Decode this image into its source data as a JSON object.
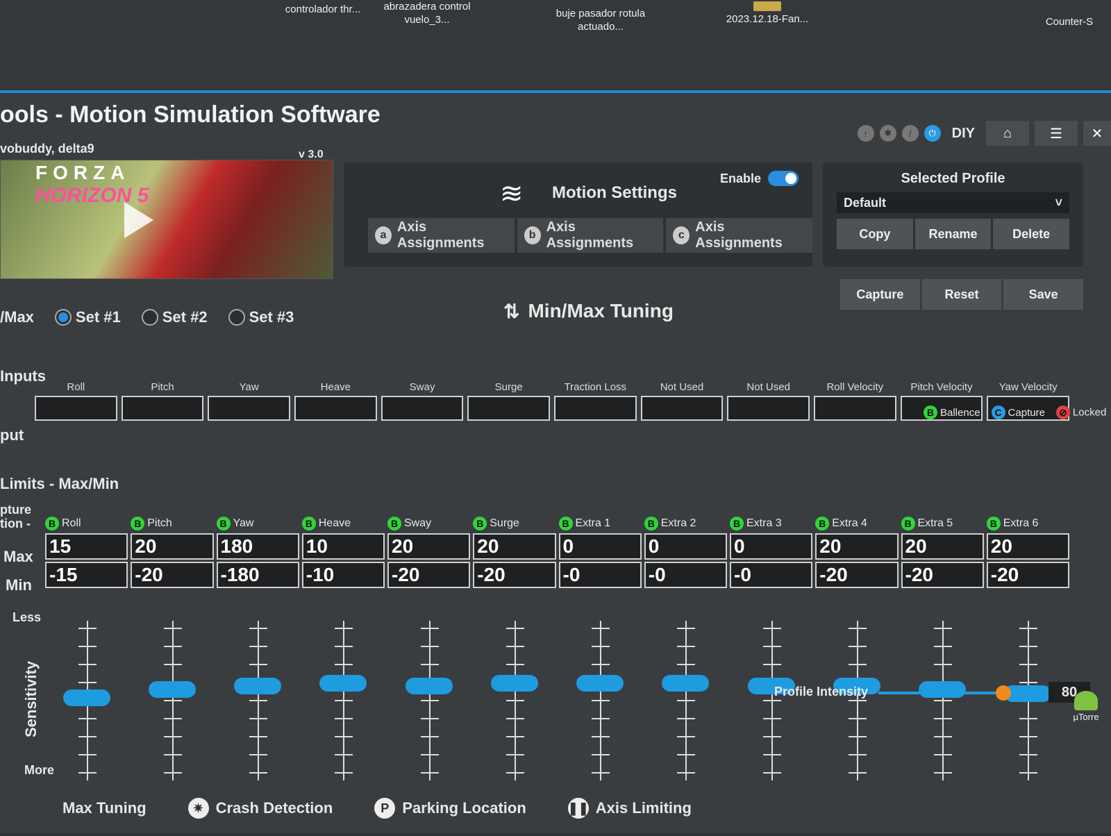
{
  "desktop": {
    "icons": [
      "controlador thr...",
      "abrazadera control vuelo_3...",
      "buje pasador rotula actuado...",
      "2023.12.18-Fan...",
      "Counter-S",
      "µTorre"
    ]
  },
  "window": {
    "title": "ools - Motion Simulation Software",
    "credit": "vobuddy, delta9",
    "version": "v 3.0",
    "mode": "DIY",
    "close": "✕"
  },
  "game": {
    "brand": "FORZA",
    "name": "HORIZON 5"
  },
  "motion": {
    "title": "Motion Settings",
    "enable_label": "Enable",
    "enabled": true,
    "tabs": [
      {
        "letter": "a",
        "label": "Axis Assignments"
      },
      {
        "letter": "b",
        "label": "Axis Assignments"
      },
      {
        "letter": "c",
        "label": "Axis Assignments"
      }
    ]
  },
  "profile": {
    "title": "Selected Profile",
    "selected": "Default",
    "buttons": [
      "Copy",
      "Rename",
      "Delete"
    ],
    "actions": [
      "Capture",
      "Reset",
      "Save"
    ]
  },
  "tuning": {
    "label": "/Max",
    "title": "Min/Max Tuning",
    "sets": [
      "Set #1",
      "Set #2",
      "Set #3"
    ],
    "selected_set": 0
  },
  "inputs": {
    "title": "Inputs",
    "row_label": "put",
    "columns": [
      "Roll",
      "Pitch",
      "Yaw",
      "Heave",
      "Sway",
      "Surge",
      "Traction Loss",
      "Not Used",
      "Not Used",
      "Roll Velocity",
      "Pitch Velocity",
      "Yaw Velocity"
    ]
  },
  "legend": [
    {
      "letter": "B",
      "label": "Ballence",
      "color": "#2fd63a"
    },
    {
      "letter": "C",
      "label": "Capture",
      "color": "#2a9be0"
    },
    {
      "letter": "⊘",
      "label": "Locked",
      "color": "#e04040"
    }
  ],
  "limits": {
    "title": "Limits - Max/Min",
    "side_label_1": "pture",
    "side_label_2": "tion -",
    "max_label": "Max",
    "min_label": "Min",
    "axes": [
      {
        "name": "Roll",
        "max": "15",
        "min": "-15"
      },
      {
        "name": "Pitch",
        "max": "20",
        "min": "-20"
      },
      {
        "name": "Yaw",
        "max": "180",
        "min": "-180"
      },
      {
        "name": "Heave",
        "max": "10",
        "min": "-10"
      },
      {
        "name": "Sway",
        "max": "20",
        "min": "-20"
      },
      {
        "name": "Surge",
        "max": "20",
        "min": "-20"
      },
      {
        "name": "Extra 1",
        "max": "0",
        "min": "-0"
      },
      {
        "name": "Extra 2",
        "max": "0",
        "min": "-0"
      },
      {
        "name": "Extra 3",
        "max": "0",
        "min": "-0"
      },
      {
        "name": "Extra 4",
        "max": "20",
        "min": "-20"
      },
      {
        "name": "Extra 5",
        "max": "20",
        "min": "-20"
      },
      {
        "name": "Extra 6",
        "max": "20",
        "min": "-20"
      }
    ]
  },
  "sensitivity": {
    "label": "Sensitivity",
    "less": "Less",
    "more": "More",
    "values": [
      0.48,
      0.42,
      0.4,
      0.38,
      0.4,
      0.38,
      0.38,
      0.38,
      0.4,
      0.4,
      0.42,
      0.45
    ]
  },
  "intensity": {
    "label": "Profile Intensity",
    "value": "80",
    "fraction": 0.8
  },
  "bottom_tabs": [
    {
      "icon": "❚❚",
      "label": "Axis Limiting"
    },
    {
      "icon": "P",
      "label": "Parking Location"
    },
    {
      "icon": "✷",
      "label": "Crash Detection"
    },
    {
      "icon": "",
      "label": "Max Tuning"
    }
  ]
}
